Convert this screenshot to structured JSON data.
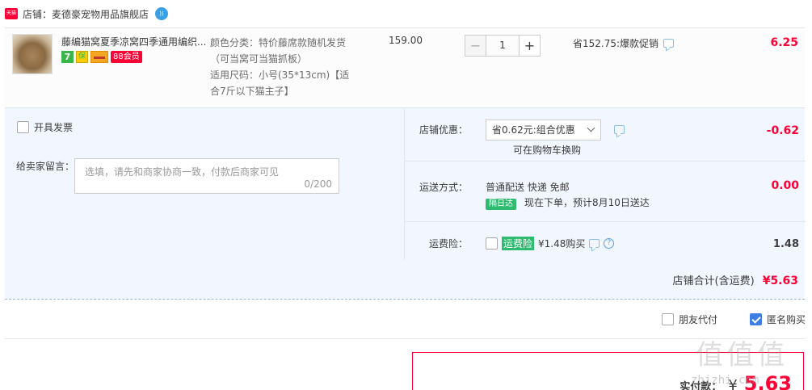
{
  "shop": {
    "badge_text": "天猫",
    "label": "店铺：麦德豪宠物用品旗舰店",
    "wang_icon": "wangwang-icon"
  },
  "item": {
    "title": "藤编猫窝夏季凉窝四季通用编织...",
    "icon_7": "7",
    "icon_shield": "保",
    "icon_88": "88会员",
    "props": [
      "颜色分类：特价藤席款随机发货",
      "（可当窝可当猫抓板）",
      "适用尺码：小号(35*13cm)【适",
      "合7斤以下猫主子】"
    ],
    "price": "159.00",
    "qty_minus": "−",
    "qty_value": "1",
    "qty_plus": "+",
    "discount": "省152.75:爆款促销",
    "total": "6.25"
  },
  "invoice": {
    "label": "开具发票"
  },
  "message": {
    "label": "给卖家留言：",
    "placeholder": "选填，请先和商家协商一致，付款后商家可见",
    "counter": "0/200"
  },
  "shop_discount": {
    "label": "店铺优惠：",
    "selected": "省0.62元:组合优惠",
    "note": "可在购物车换购",
    "value": "-0.62"
  },
  "shipping": {
    "label": "运送方式：",
    "method": "普通配送 快递 免邮",
    "badge": "隔日达",
    "eta": "现在下单，预计8月10日送达",
    "value": "0.00"
  },
  "insurance": {
    "label": "运费险：",
    "tag": "运费险",
    "price_text": "¥1.48购买",
    "help": "?",
    "value": "1.48"
  },
  "shop_total": {
    "label": "店铺合计(含运费)",
    "value": "¥5.63"
  },
  "bottom_options": {
    "friend_pay": "朋友代付",
    "anonymous": "匿名购买"
  },
  "payment": {
    "label": "实付款：",
    "currency": "¥",
    "amount": "5.63"
  },
  "watermark": {
    "glyphs": "值值值",
    "text": "zhizhi.com"
  },
  "colors": {
    "accent_red": "#ff0036",
    "panel_blue": "#f2f7ff",
    "green_badge": "#2dbb6f",
    "checkbox_blue": "#3d7ee6"
  }
}
